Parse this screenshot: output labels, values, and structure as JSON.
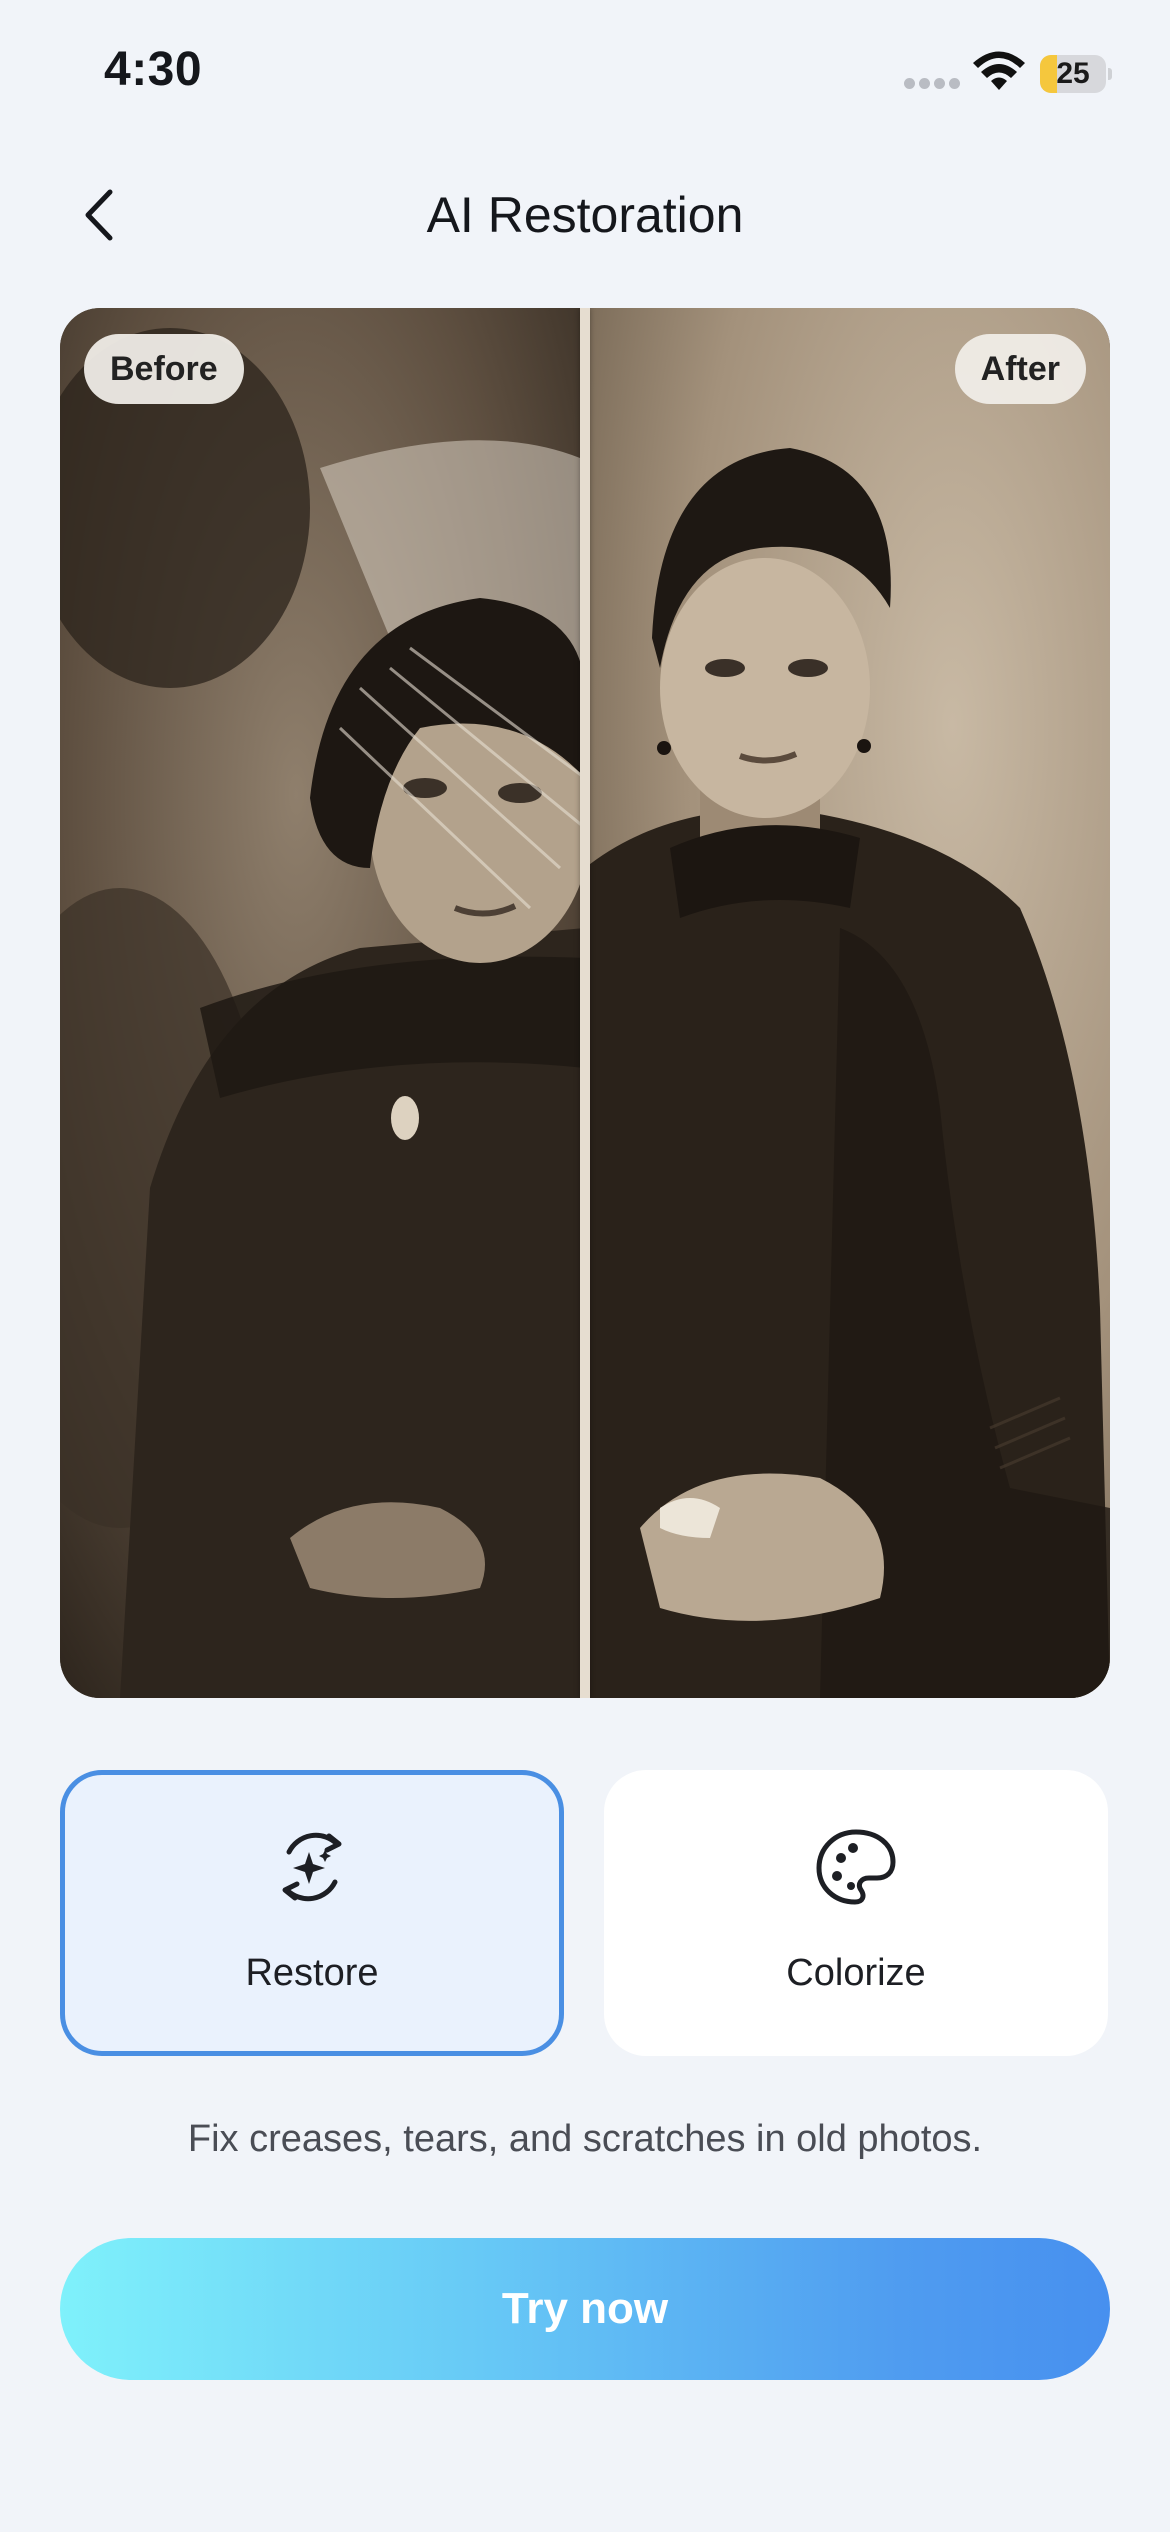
{
  "status_bar": {
    "time": "4:30",
    "battery_level": "25",
    "battery_fraction": 0.25,
    "battery_color": "#f5c73d",
    "icons": [
      "signal-dots-icon",
      "wifi-icon",
      "battery-icon"
    ]
  },
  "header": {
    "title": "AI Restoration",
    "back_icon": "chevron-left-icon"
  },
  "comparison": {
    "before_label": "Before",
    "after_label": "After",
    "split_fraction": 0.5
  },
  "modes": [
    {
      "label": "Restore",
      "icon": "restore-sparkle-icon",
      "selected": true
    },
    {
      "label": "Colorize",
      "icon": "palette-icon",
      "selected": false
    }
  ],
  "description": "Fix creases, tears, and scratches in old photos.",
  "cta": {
    "label": "Try now",
    "gradient_start": "#7ff1fb",
    "gradient_end": "#4790ef"
  },
  "colors": {
    "background": "#f1f4f9",
    "selected_border": "#4a8fe3",
    "selected_fill": "#eaf2fd"
  }
}
